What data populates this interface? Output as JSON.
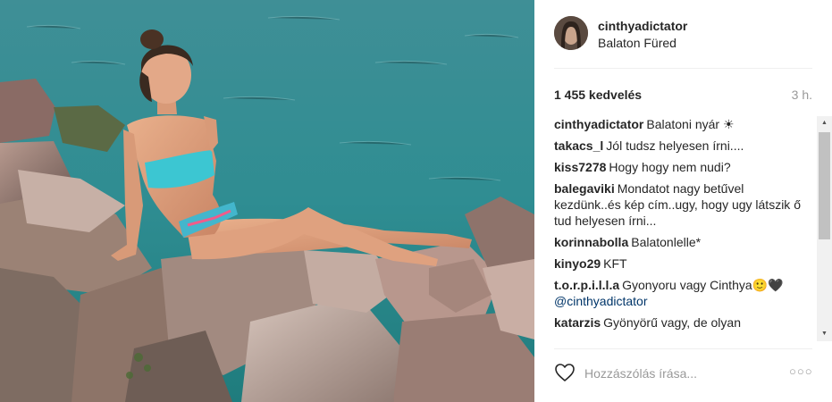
{
  "post": {
    "username": "cinthyadictator",
    "location": "Balaton Füred",
    "likes": "1 455 kedvelés",
    "time": "3 h."
  },
  "comments": [
    {
      "user": "cinthyadictator",
      "text": "Balatoni nyár ☀"
    },
    {
      "user": "takacs_l",
      "text": "Jól tudsz helyesen írni...."
    },
    {
      "user": "kiss7278",
      "text": "Hogy hogy nem nudi?"
    },
    {
      "user": "balegaviki",
      "text": "Mondatot nagy betűvel kezdünk..és kép cím..ugy, hogy ugy látszik ő tud helyesen írni..."
    },
    {
      "user": "korinnabolla",
      "text": "Balatonlelle*"
    },
    {
      "user": "kinyo29",
      "text": "KFT"
    },
    {
      "user": "t.o.r.p.i.l.l.a",
      "text": "Gyonyoru vagy Cinthya🙂🖤",
      "mention": "@cinthyadictator"
    },
    {
      "user": "katarzis",
      "text": "Gyönyörű vagy, de olyan"
    }
  ],
  "comment_box": {
    "placeholder": "Hozzászólás írása..."
  },
  "icons": {
    "like": "heart-icon",
    "more": "more-options-icon",
    "scroll_up": "scroll-up-arrow-icon",
    "scroll_down": "scroll-down-arrow-icon"
  },
  "colors": {
    "username_text": "#262626",
    "muted_text": "#999999",
    "mention": "#003569",
    "divider": "#efefef"
  }
}
